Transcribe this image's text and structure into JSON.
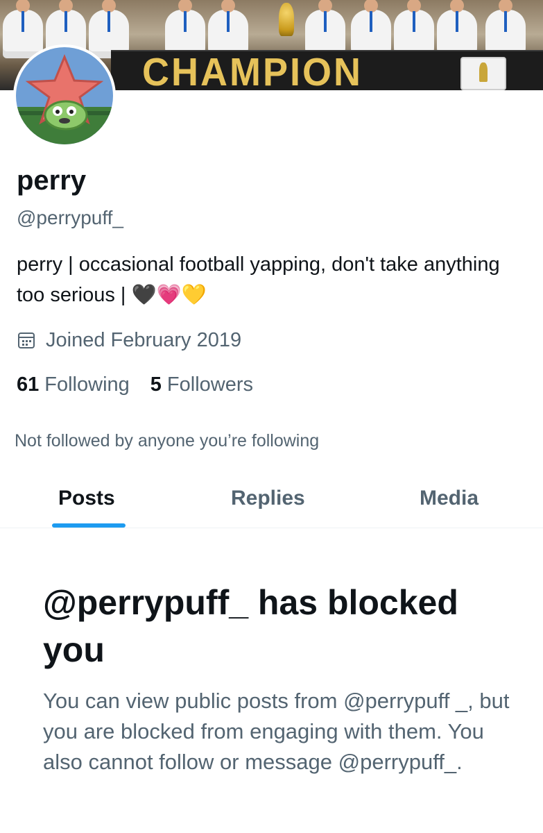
{
  "banner": {
    "champion_text": "CHAMPION"
  },
  "profile": {
    "name": "perry",
    "handle": "@perrypuff_",
    "bio": "perry | occasional football yapping, don't take anything too serious | 🖤💗💛",
    "joined": "Joined February 2019",
    "following_count": "61",
    "following_label": "Following",
    "followers_count": "5",
    "followers_label": "Followers",
    "not_followed": "Not followed by anyone you’re following"
  },
  "tabs": [
    {
      "label": "Posts",
      "active": true
    },
    {
      "label": "Replies",
      "active": false
    },
    {
      "label": "Media",
      "active": false
    }
  ],
  "blocked": {
    "title": "@perrypuff_ has blocked you",
    "body": "You can view public posts from @perrypuff _, but you are blocked from engaging with them. You also cannot follow or message @perrypuff_."
  },
  "colors": {
    "accent": "#1d9bf0",
    "secondary_text": "#536471",
    "primary_text": "#0f1419"
  },
  "icons": {
    "joined": "calendar-icon"
  }
}
